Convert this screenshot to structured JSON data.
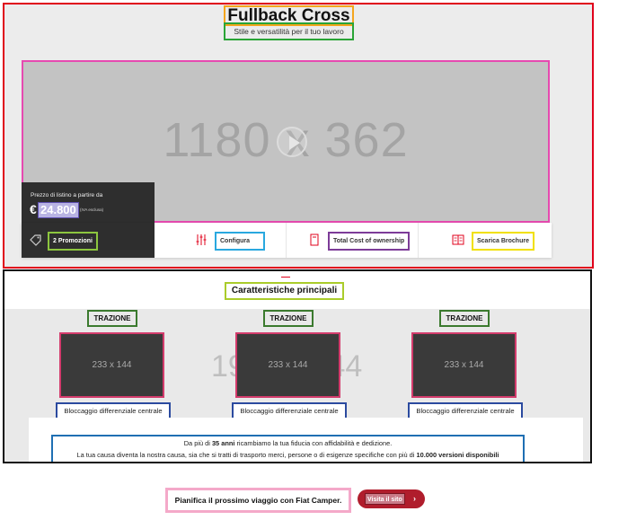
{
  "hero": {
    "title": "Fullback Cross",
    "subtitle": "Stile e versatilità per il tuo lavoro",
    "image_placeholder": "1180 x 362",
    "price": {
      "caption": "Prezzo di listino a partire da",
      "currency": "€",
      "value": "24.800",
      "vat_note": "(IVA esclusa)"
    },
    "actions": [
      {
        "label": "2 Promozioni",
        "icon": "tag-icon"
      },
      {
        "label": "Configura",
        "icon": "sliders-icon"
      },
      {
        "label": "Total Cost of ownership",
        "icon": "calculator-icon"
      },
      {
        "label": "Scarica Brochure",
        "icon": "brochure-icon"
      }
    ]
  },
  "features": {
    "title": "Caratteristiche principali",
    "background_label": "1920 x 644",
    "cards": [
      {
        "tag": "TRAZIONE",
        "image_placeholder": "233 x 144",
        "description": "Bloccaggio differenziale centrale"
      },
      {
        "tag": "TRAZIONE",
        "image_placeholder": "233 x 144",
        "description": "Bloccaggio differenziale centrale"
      },
      {
        "tag": "TRAZIONE",
        "image_placeholder": "233 x 144",
        "description": "Bloccaggio differenziale centrale"
      }
    ],
    "about": {
      "line1_prefix": "Da più di ",
      "line1_bold": "35 anni",
      "line1_suffix": " ricambiamo la tua fiducia con affidabilità e dedizione.",
      "line2_prefix": "La tua causa diventa la nostra causa, sia che si tratti di trasporto merci, persone o di esigenze specifiche con più di ",
      "line2_bold": "10.000 versioni disponibili"
    }
  },
  "cta": {
    "text": "Pianifica il prossimo viaggio con Fiat Camper.",
    "button_label": "Visita il sito",
    "button_arrow": "›"
  },
  "colors": {
    "brand_red": "#e0001b",
    "dark_panel": "#2e2e2e",
    "cta_red": "#b01d2c"
  }
}
